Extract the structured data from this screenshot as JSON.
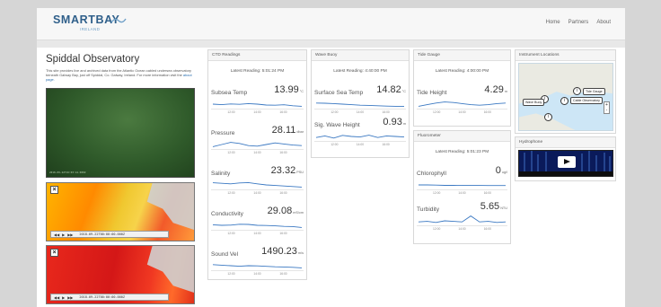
{
  "header": {
    "logo_text": "SMARTBAY",
    "logo_sub": "IRELAND",
    "nav": [
      "Home",
      "Partners",
      "About"
    ]
  },
  "intro": {
    "title": "Spiddal Observatory",
    "text": "This site provides live and archived data from the Atlantic Ocean cabled undersea observatory beneath Galway Bay, just off Spiddal, Co. Galway, Ireland. For more information visit the",
    "link": "about page."
  },
  "video": {
    "stamp": "2018-09-22T16:03:14.000Z"
  },
  "maps": [
    {
      "timestamp": "2018-09-22T00:00:00.000Z"
    },
    {
      "timestamp": "2018-09-22T00:00:00.000Z"
    }
  ],
  "ctd": {
    "title": "CTD Readings",
    "latest": "Latest Reading: 5:01:24 PM",
    "metrics": [
      {
        "name": "Subsea Temp",
        "value": "13.99",
        "unit": "°C"
      },
      {
        "name": "Pressure",
        "value": "28.11",
        "unit": "dbar"
      },
      {
        "name": "Salinity",
        "value": "23.32",
        "unit": "PSU"
      },
      {
        "name": "Conductivity",
        "value": "29.08",
        "unit": "mS/cm"
      },
      {
        "name": "Sound Vel",
        "value": "1490.23",
        "unit": "m/s"
      }
    ]
  },
  "wave": {
    "title": "Wave Buoy",
    "latest": "Latest Reading: 4:40:00 PM",
    "metrics": [
      {
        "name": "Surface Sea Temp",
        "value": "14.82",
        "unit": "°C"
      },
      {
        "name": "Sig. Wave Height",
        "value": "0.93",
        "unit": "m"
      }
    ]
  },
  "tide": {
    "title": "Tide Gauge",
    "latest": "Latest Reading: 4:00:00 PM",
    "metrics": [
      {
        "name": "Tide Height",
        "value": "4.29",
        "unit": "m"
      }
    ]
  },
  "fluoro": {
    "title": "Fluorometer",
    "latest": "Latest Reading: 5:01:23 PM",
    "metrics": [
      {
        "name": "Chlorophyll",
        "value": "0",
        "unit": "ug/l"
      },
      {
        "name": "Turbidity",
        "value": "5.65",
        "unit": "NTU"
      }
    ]
  },
  "spark_ticks": [
    "12:00",
    "14:00",
    "16:00"
  ],
  "locations": {
    "title": "Instrument Locations",
    "labels": [
      "Tide Gauge",
      "Cable Observatory",
      "Wave Buoy"
    ],
    "zoom_in": "+",
    "zoom_out": "-"
  },
  "hydrophone": {
    "title": "Hydrophone"
  },
  "colors": {
    "accent": "#2f5f8a",
    "spark": "#3a78c2",
    "link": "#2a6fb0"
  }
}
